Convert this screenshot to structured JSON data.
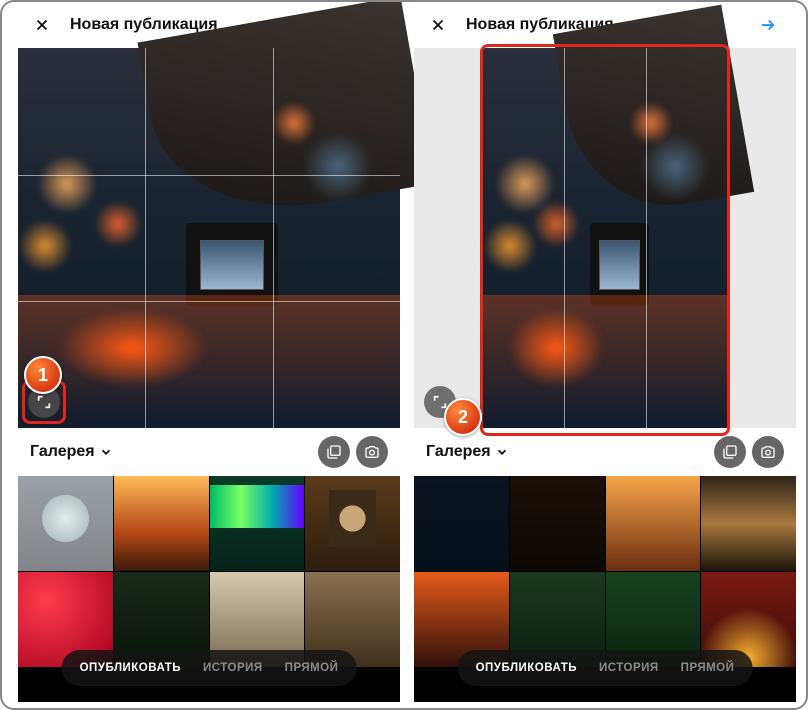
{
  "header": {
    "title": "Новая публикация"
  },
  "source": {
    "label": "Галерея"
  },
  "modes": {
    "publish": "ОПУБЛИКОВАТЬ",
    "story": "ИСТОРИЯ",
    "live": "ПРЯМОЙ"
  },
  "steps": {
    "one": "1",
    "two": "2"
  }
}
